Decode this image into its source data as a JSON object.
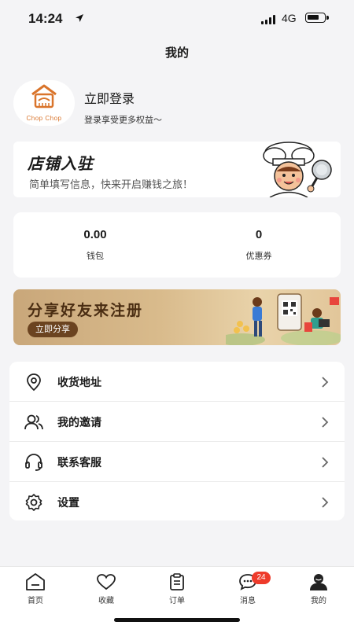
{
  "status": {
    "time": "14:24",
    "network": "4G"
  },
  "page": {
    "title": "我的"
  },
  "profile": {
    "brand": "Chop Chop",
    "login_title": "立即登录",
    "login_subtitle": "登录享受更多权益～"
  },
  "store_banner": {
    "title": "店铺入驻",
    "subtitle": "简单填写信息，快来开启赚钱之旅！"
  },
  "wallet": {
    "balance_value": "0.00",
    "balance_label": "钱包",
    "coupon_value": "0",
    "coupon_label": "优惠券"
  },
  "share_banner": {
    "title": "分享好友来注册",
    "button": "立即分享"
  },
  "menu": {
    "items": [
      {
        "label": "收货地址",
        "icon": "location-icon"
      },
      {
        "label": "我的邀请",
        "icon": "users-icon"
      },
      {
        "label": "联系客服",
        "icon": "headset-icon"
      },
      {
        "label": "设置",
        "icon": "gear-icon"
      }
    ]
  },
  "tabbar": {
    "items": [
      {
        "label": "首页",
        "icon": "home-icon"
      },
      {
        "label": "收藏",
        "icon": "heart-icon"
      },
      {
        "label": "订单",
        "icon": "clipboard-icon"
      },
      {
        "label": "消息",
        "icon": "chat-icon",
        "badge": "24"
      },
      {
        "label": "我的",
        "icon": "user-icon",
        "active": true
      }
    ]
  },
  "colors": {
    "accent": "#ee3b2b",
    "brand_orange": "#d9742b",
    "share_button": "#6b4320"
  }
}
